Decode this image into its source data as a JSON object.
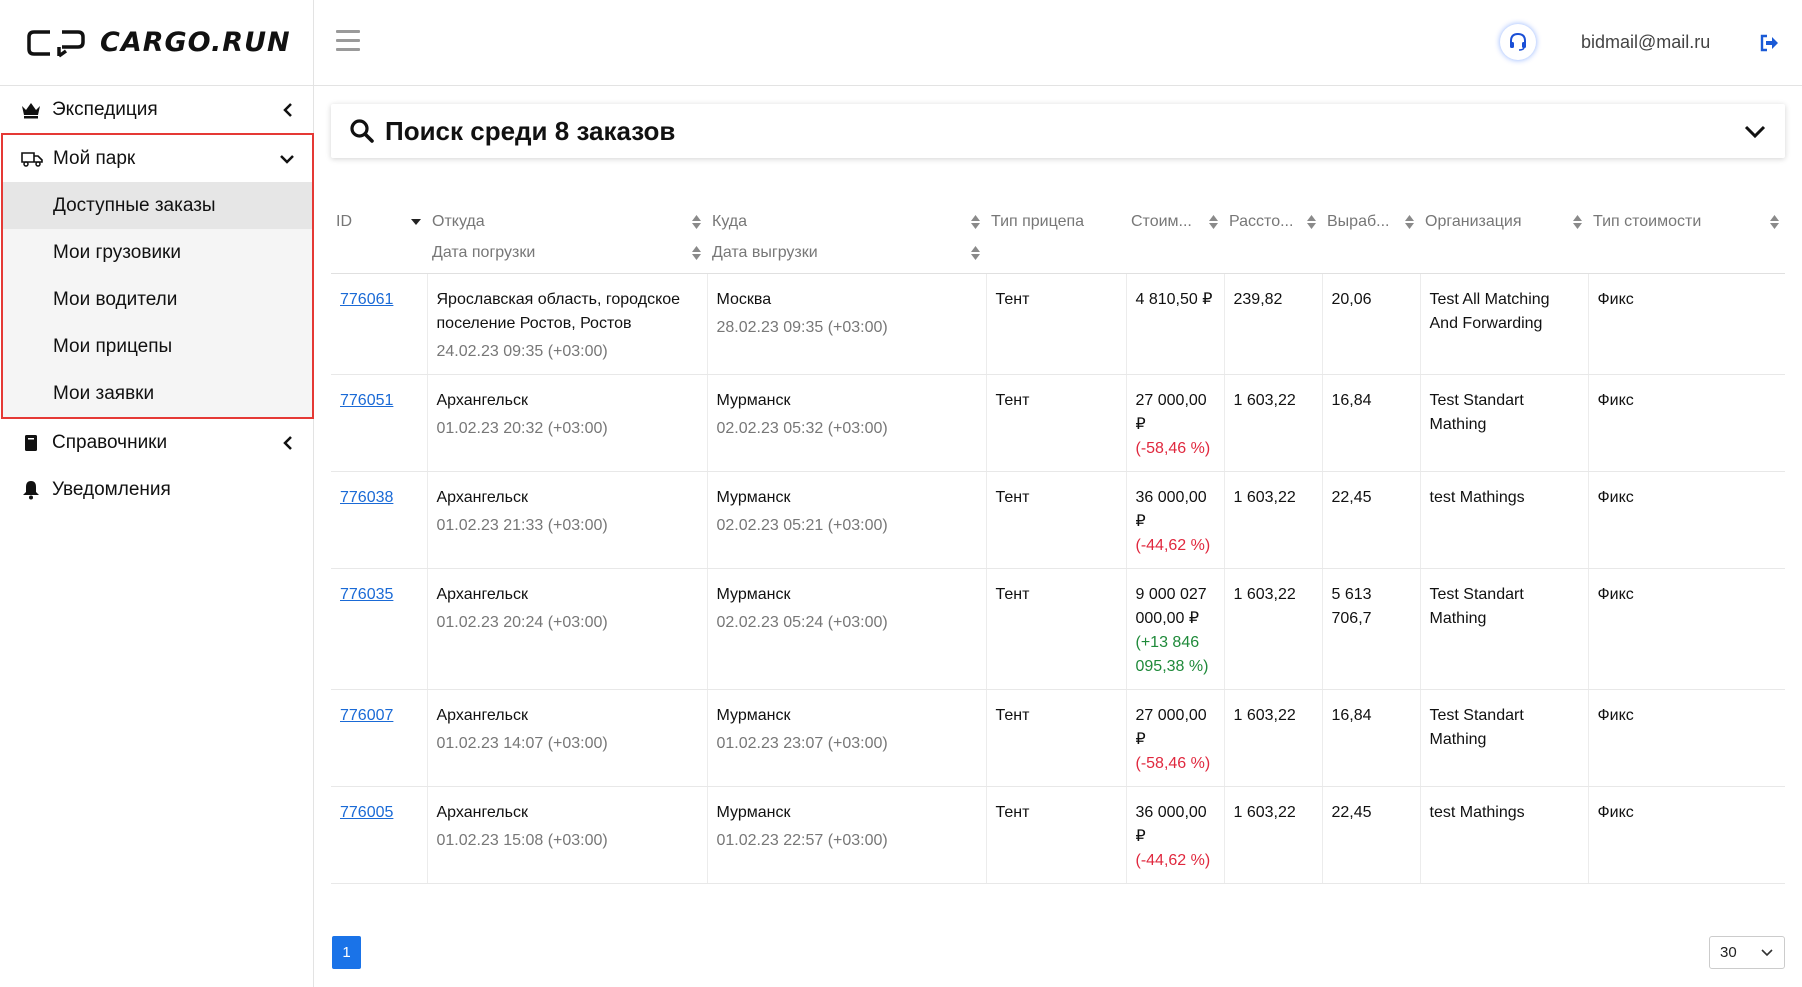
{
  "brand": {
    "name": "CARGO.RUN"
  },
  "sidebar": {
    "items": [
      {
        "label": "Экспедиция",
        "icon": "crown-icon"
      },
      {
        "label": "Мой парк",
        "icon": "truck-icon",
        "children": [
          "Доступные заказы",
          "Мои грузовики",
          "Мои водители",
          "Мои прицепы",
          "Мои заявки"
        ]
      },
      {
        "label": "Справочники",
        "icon": "book-icon"
      },
      {
        "label": "Уведомления",
        "icon": "bell-icon"
      }
    ]
  },
  "header": {
    "email": "bidmail@mail.ru"
  },
  "search": {
    "title": "Поиск среди 8 заказов"
  },
  "table": {
    "headers": {
      "id": "ID",
      "from": "Откуда",
      "load_date": "Дата погрузки",
      "to": "Куда",
      "unload_date": "Дата выгрузки",
      "trailer": "Тип прицепа",
      "cost": "Стоим...",
      "distance": "Рассто...",
      "output": "Выраб...",
      "org": "Организация",
      "cost_type": "Тип стоимости"
    },
    "rows": [
      {
        "id": "776061",
        "from": "Ярославская область, городское поселение Ростов, Ростов",
        "load_date": "24.02.23 09:35 (+03:00)",
        "to": "Москва",
        "unload_date": "28.02.23 09:35 (+03:00)",
        "trailer": "Тент",
        "cost": "4 810,50 ₽",
        "delta": "",
        "delta_class": "",
        "distance": "239,82",
        "output": "20,06",
        "org": "Test All Matching And Forwarding",
        "cost_type": "Фикс"
      },
      {
        "id": "776051",
        "from": "Архангельск",
        "load_date": "01.02.23 20:32 (+03:00)",
        "to": "Мурманск",
        "unload_date": "02.02.23 05:32 (+03:00)",
        "trailer": "Тент",
        "cost": "27 000,00 ₽",
        "delta": "(-58,46 %)",
        "delta_class": "neg",
        "distance": "1 603,22",
        "output": "16,84",
        "org": "Test Standart Mathing",
        "cost_type": "Фикс"
      },
      {
        "id": "776038",
        "from": "Архангельск",
        "load_date": "01.02.23 21:33 (+03:00)",
        "to": "Мурманск",
        "unload_date": "02.02.23 05:21 (+03:00)",
        "trailer": "Тент",
        "cost": "36 000,00 ₽",
        "delta": "(-44,62 %)",
        "delta_class": "neg",
        "distance": "1 603,22",
        "output": "22,45",
        "org": "test Mathings",
        "cost_type": "Фикс"
      },
      {
        "id": "776035",
        "from": "Архангельск",
        "load_date": "01.02.23 20:24 (+03:00)",
        "to": "Мурманск",
        "unload_date": "02.02.23 05:24 (+03:00)",
        "trailer": "Тент",
        "cost": "9 000 027 000,00 ₽",
        "delta": "(+13 846 095,38 %)",
        "delta_class": "pos",
        "distance": "1 603,22",
        "output": "5 613 706,7",
        "org": "Test Standart Mathing",
        "cost_type": "Фикс"
      },
      {
        "id": "776007",
        "from": "Архангельск",
        "load_date": "01.02.23 14:07 (+03:00)",
        "to": "Мурманск",
        "unload_date": "01.02.23 23:07 (+03:00)",
        "trailer": "Тент",
        "cost": "27 000,00 ₽",
        "delta": "(-58,46 %)",
        "delta_class": "neg",
        "distance": "1 603,22",
        "output": "16,84",
        "org": "Test Standart Mathing",
        "cost_type": "Фикс"
      },
      {
        "id": "776005",
        "from": "Архангельск",
        "load_date": "01.02.23 15:08 (+03:00)",
        "to": "Мурманск",
        "unload_date": "01.02.23 22:57 (+03:00)",
        "trailer": "Тент",
        "cost": "36 000,00 ₽",
        "delta": "(-44,62 %)",
        "delta_class": "neg",
        "distance": "1 603,22",
        "output": "22,45",
        "org": "test Mathings",
        "cost_type": "Фикс"
      }
    ]
  },
  "pagination": {
    "current_page": "1",
    "per_page": "30"
  }
}
